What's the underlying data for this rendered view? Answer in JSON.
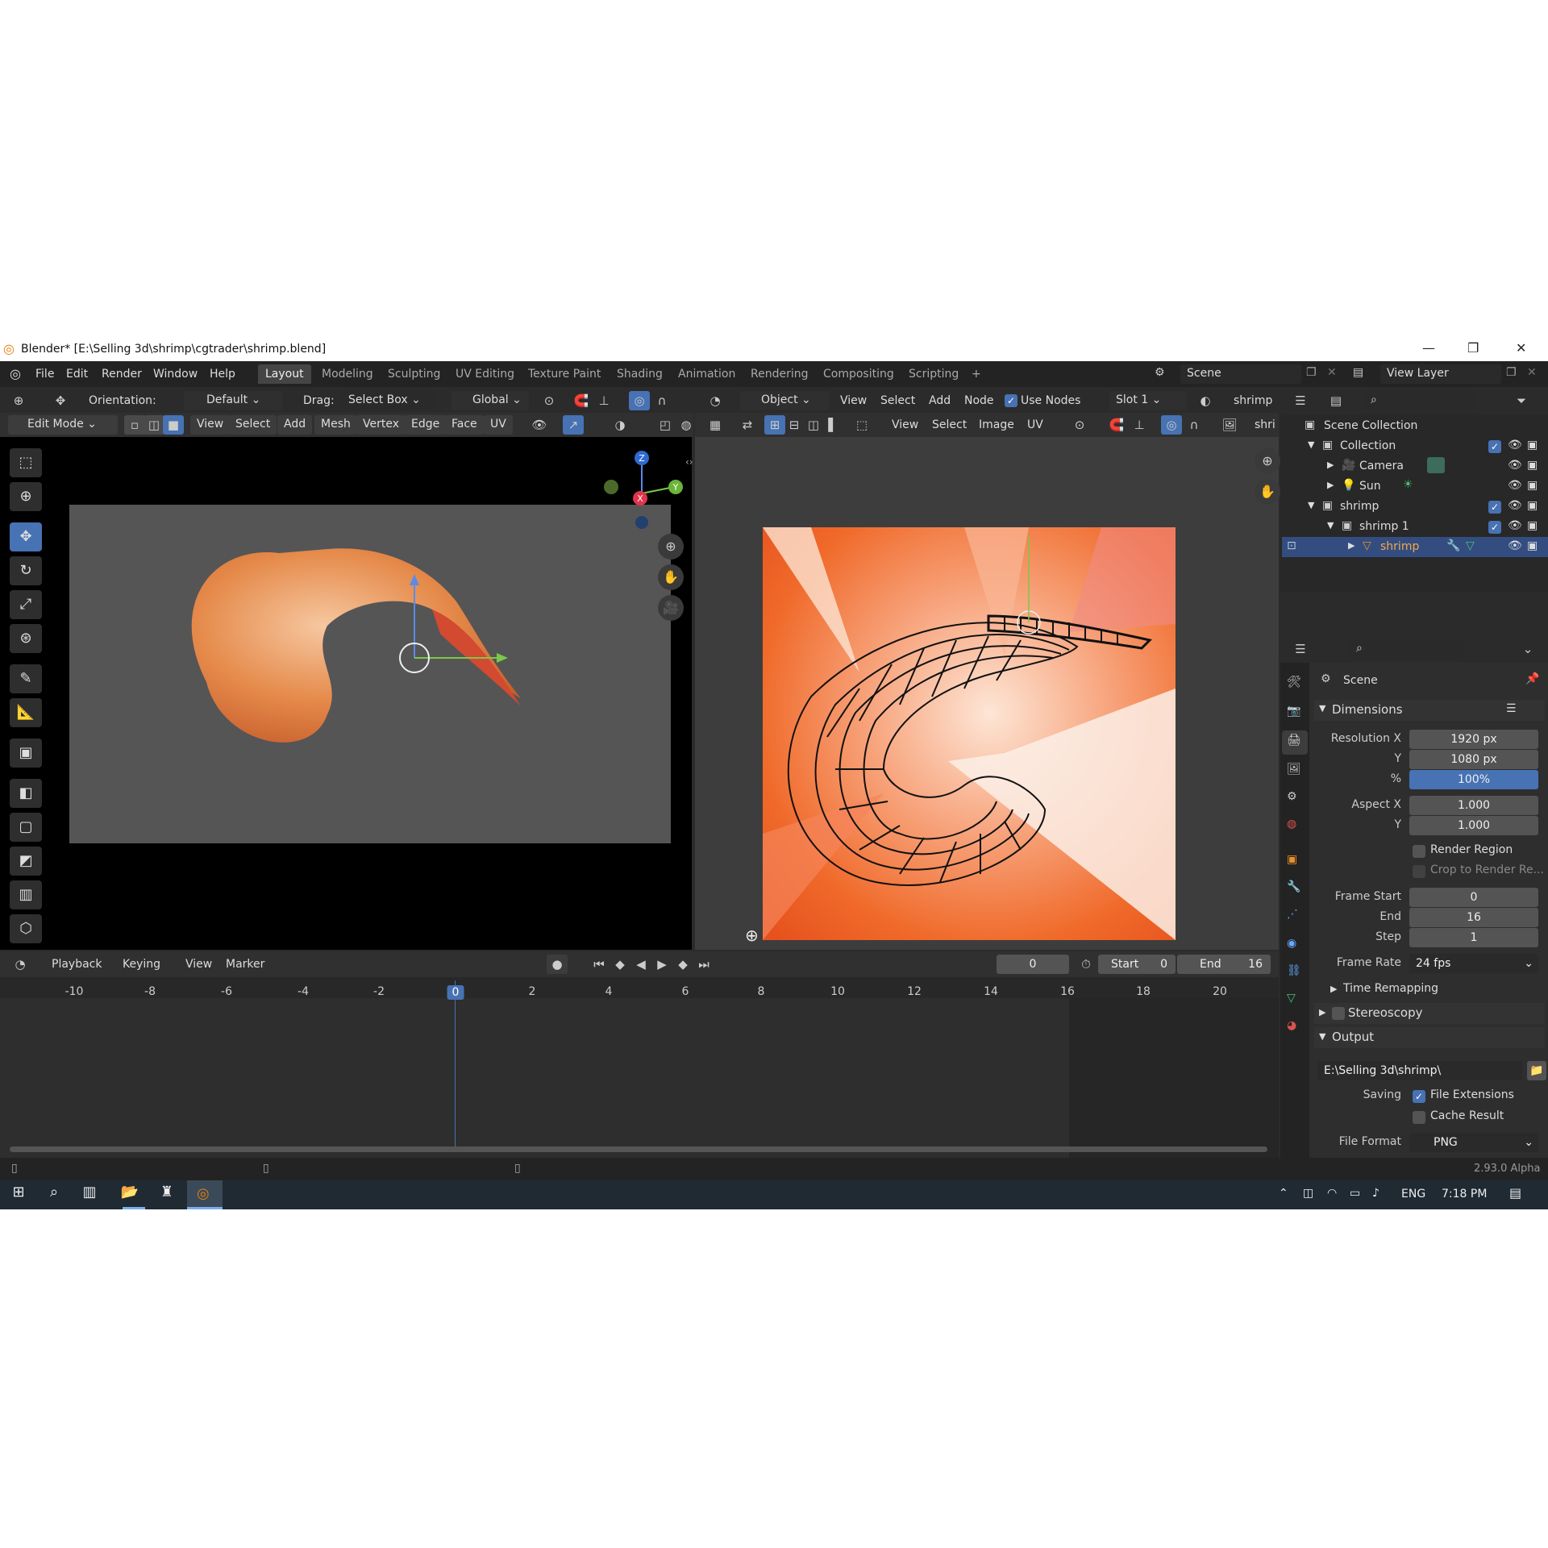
{
  "window_title": "Blender* [E:\\Selling 3d\\shrimp\\cgtrader\\shrimp.blend]",
  "menu": [
    "File",
    "Edit",
    "Render",
    "Window",
    "Help"
  ],
  "workspaces": [
    "Layout",
    "Modeling",
    "Sculpting",
    "UV Editing",
    "Texture Paint",
    "Shading",
    "Animation",
    "Rendering",
    "Compositing",
    "Scripting"
  ],
  "scene": "Scene",
  "view_layer": "View Layer",
  "view3d": {
    "orientation_label": "Orientation:",
    "orientation": "Default",
    "drag_label": "Drag:",
    "drag": "Select Box",
    "transform": "Global",
    "mode": "Edit Mode",
    "menus": [
      "View",
      "Select",
      "Add",
      "Mesh",
      "Vertex",
      "Edge",
      "Face",
      "UV"
    ],
    "gizmo": {
      "z": "Z",
      "x": "X",
      "y": "Y"
    }
  },
  "uv": {
    "object": "Object",
    "menus_top": [
      "View",
      "Select",
      "Add",
      "Node"
    ],
    "use_nodes": "Use Nodes",
    "slot": "Slot 1",
    "material": "shrimp",
    "menus": [
      "View",
      "Select",
      "Image",
      "UV"
    ],
    "image_name": "shri"
  },
  "outliner": {
    "rows": [
      {
        "label": "Scene Collection",
        "indent": 0
      },
      {
        "label": "Collection",
        "indent": 1
      },
      {
        "label": "Camera",
        "indent": 2
      },
      {
        "label": "Sun",
        "indent": 2
      },
      {
        "label": "shrimp",
        "indent": 1
      },
      {
        "label": "shrimp 1",
        "indent": 2
      },
      {
        "label": "shrimp",
        "indent": 3,
        "selected": true
      }
    ]
  },
  "props": {
    "context": "Scene",
    "dimensions": "Dimensions",
    "res_x_label": "Resolution X",
    "res_x": "1920 px",
    "res_y_label": "Y",
    "res_y": "1080 px",
    "pct_label": "%",
    "pct": "100%",
    "aspect_x_label": "Aspect X",
    "aspect_x": "1.000",
    "aspect_y_label": "Y",
    "aspect_y": "1.000",
    "render_region": "Render Region",
    "crop": "Crop to Render Re...",
    "frame_start_label": "Frame Start",
    "frame_start": "0",
    "end_label": "End",
    "end": "16",
    "step_label": "Step",
    "step": "1",
    "frame_rate_label": "Frame Rate",
    "frame_rate": "24 fps",
    "time_remapping": "Time Remapping",
    "stereoscopy": "Stereoscopy",
    "output": "Output",
    "output_path": "E:\\Selling 3d\\shrimp\\",
    "saving_label": "Saving",
    "file_extensions": "File Extensions",
    "cache_result": "Cache Result",
    "file_format_label": "File Format",
    "file_format": "PNG"
  },
  "timeline": {
    "menus": [
      "Playback",
      "Keying",
      "View",
      "Marker"
    ],
    "current": "0",
    "start_label": "Start",
    "start": "0",
    "end_label": "End",
    "end": "16",
    "ticks": [
      "-10",
      "-8",
      "-6",
      "-4",
      "-2",
      "0",
      "2",
      "4",
      "6",
      "8",
      "10",
      "12",
      "14",
      "16",
      "18",
      "20"
    ],
    "current_tick": "0"
  },
  "status": {
    "version": "2.93.0 Alpha"
  },
  "taskbar": {
    "lang": "ENG",
    "time": "7:18 PM"
  }
}
